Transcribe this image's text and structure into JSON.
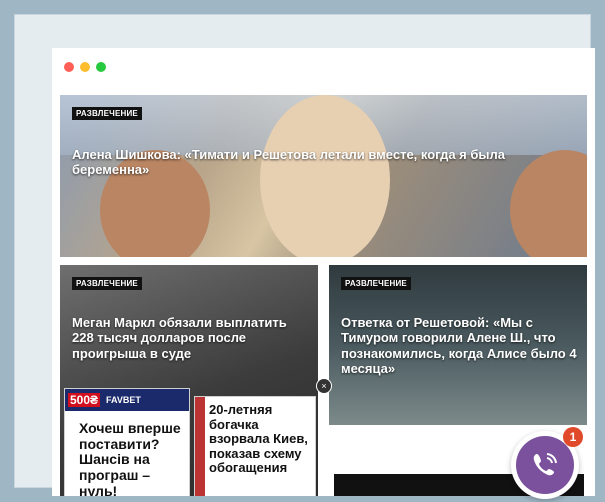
{
  "window": {
    "dots": [
      {
        "name": "close-dot",
        "color": "#ff5f56"
      },
      {
        "name": "minimize-dot",
        "color": "#ffbd2e"
      },
      {
        "name": "maximize-dot",
        "color": "#27c93f"
      }
    ]
  },
  "articles": [
    {
      "tag": "РАЗВЛЕЧЕНИЕ",
      "title": "Алена Шишкова: «Тимати и Решетова летали вместе, когда я была беременна»"
    },
    {
      "tag": "РАЗВЛЕЧЕНИЕ",
      "title": "Меган Маркл обязали выплатить 228 тысяч долларов после проигрыша в суде"
    },
    {
      "tag": "РАЗВЛЕЧЕНИЕ",
      "title": "Ответка от Решетовой: «Мы с Тимуром говорили Алене Ш., что познакомились, когда Алисе было 4 месяца»"
    }
  ],
  "ads": [
    {
      "brand": "FAVBET",
      "logo_text": "500₴",
      "text": "Хочеш вперше поставити? Шансів на програш – нуль!"
    },
    {
      "text": "20-летняя богачка взорвала Киев, показав схему обогащения"
    }
  ],
  "close_glyph": "×",
  "viber": {
    "badge": "1",
    "color": "#7b519d"
  }
}
